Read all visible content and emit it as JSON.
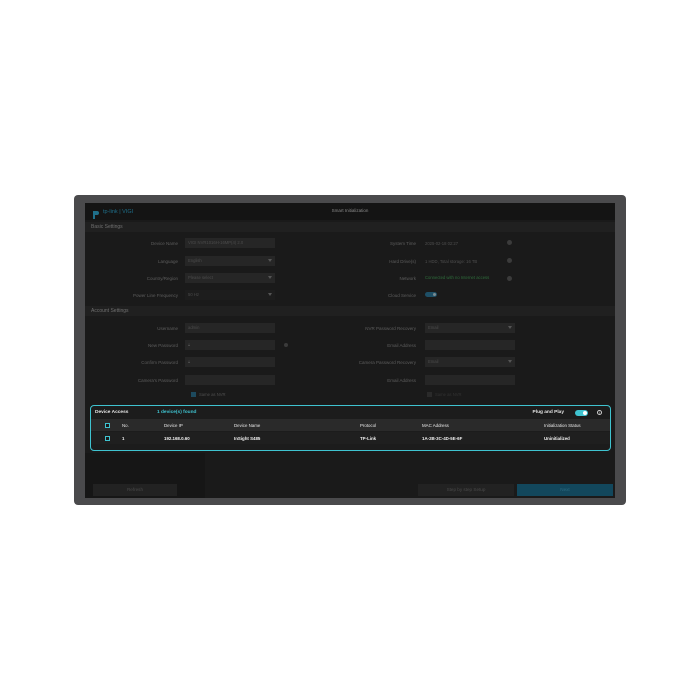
{
  "app": {
    "logo_text": "tp-link | VIGI",
    "title": "Smart Initialization"
  },
  "basic": {
    "header": "Basic Settings",
    "device_name_label": "Device Name",
    "device_name_value": "VIGI NVR1016H-16MP(4) 2.0",
    "language_label": "Language",
    "language_value": "English",
    "country_label": "Country/Region",
    "country_value": "Please select",
    "power_label": "Power Line Frequency",
    "power_value": "50 Hz",
    "system_time_label": "System Time",
    "system_time_value": "2025-02-18 02:27",
    "hdd_label": "Hard Drive(s)",
    "hdd_value": "1 HDD, Total storage: 16 TB",
    "network_label": "Network",
    "network_value": "Connected with no Internet access",
    "cloud_label": "Cloud Service"
  },
  "account": {
    "header": "Account Settings",
    "username_label": "Username",
    "username_value": "admin",
    "new_pw_label": "New Password",
    "confirm_pw_label": "Confirm Password",
    "camera_pw_label": "Camera's Password",
    "same_as_nvr": "Same as NVR",
    "nvr_recovery_label": "NVR Password Recovery",
    "nvr_recovery_value": "Email",
    "email1_label": "Email Address",
    "camera_recovery_label": "Camera Password Recovery",
    "camera_recovery_value": "Email",
    "email2_label": "Email Address",
    "same_as_nvr2": "Same as NVR"
  },
  "device_access": {
    "title": "Device Access",
    "found": "1 device(s) found",
    "plug_and_play": "Plug and Play",
    "info": "i",
    "columns": [
      "No.",
      "Device IP",
      "Device Name",
      "Protocol",
      "MAC Address",
      "Initialization Status"
    ],
    "rows": [
      [
        "1",
        "192.168.0.60",
        "InSight S485",
        "TP-Link",
        "1A-2B-3C-4D-5E-6F",
        "Uninitialized"
      ]
    ]
  },
  "buttons": {
    "refresh": "Refresh",
    "step_setup": "Step by step Setup",
    "next": "Next"
  },
  "colors": {
    "accent": "#3fc3d0",
    "network_ok": "#2f6e3c"
  }
}
